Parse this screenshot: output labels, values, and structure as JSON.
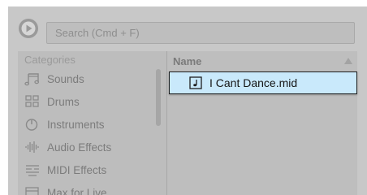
{
  "search": {
    "placeholder": "Search (Cmd + F)"
  },
  "sidebar": {
    "header": "Categories",
    "items": [
      {
        "label": "Sounds",
        "icon": "sounds-icon"
      },
      {
        "label": "Drums",
        "icon": "drums-icon"
      },
      {
        "label": "Instruments",
        "icon": "instruments-icon"
      },
      {
        "label": "Audio Effects",
        "icon": "audio-effects-icon"
      },
      {
        "label": "MIDI Effects",
        "icon": "midi-effects-icon"
      },
      {
        "label": "Max for Live",
        "icon": "max-for-live-icon"
      }
    ]
  },
  "files": {
    "column_header": "Name",
    "sort_direction": "ascending",
    "rows": [
      {
        "name": "I Cant Dance.mid",
        "icon": "midi-clip-icon",
        "selected": true
      }
    ]
  },
  "colors": {
    "window_bg": "#c8c8c8",
    "selection_bg": "#c9e9fb",
    "muted_text": "#7c7c7c"
  }
}
